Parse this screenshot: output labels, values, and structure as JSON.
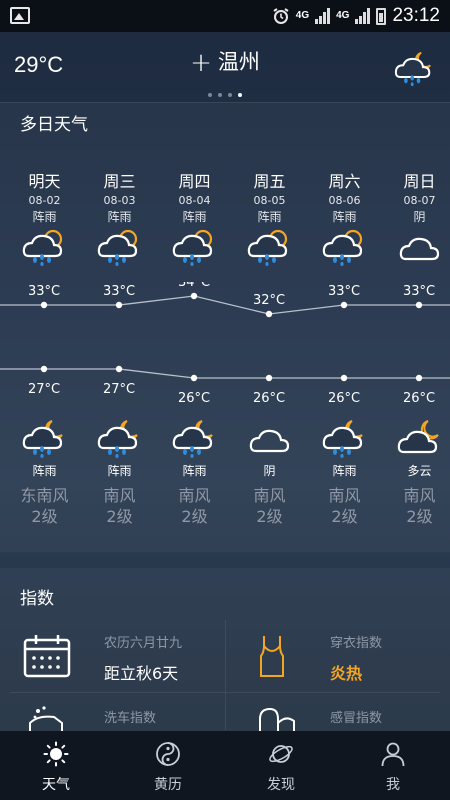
{
  "status_bar": {
    "time": "23:12",
    "network_top": "4G",
    "network_bottom": "4G"
  },
  "header": {
    "current_temp": "29°C",
    "plus": "+",
    "city": "温州",
    "weather_icon": "rain-night-icon"
  },
  "multi_day": {
    "title": "多日天气",
    "days": [
      {
        "name": "明天",
        "date": "08-02",
        "day_condition": "阵雨",
        "day_icon": "rain-day-icon",
        "high": "33°C",
        "low": "27°C",
        "night_icon": "rain-night-icon",
        "night_condition": "阵雨",
        "wind_dir": "东南风",
        "wind_level": "2级"
      },
      {
        "name": "周三",
        "date": "08-03",
        "day_condition": "阵雨",
        "day_icon": "rain-day-icon",
        "high": "33°C",
        "low": "27°C",
        "night_icon": "rain-night-icon",
        "night_condition": "阵雨",
        "wind_dir": "南风",
        "wind_level": "2级"
      },
      {
        "name": "周四",
        "date": "08-04",
        "day_condition": "阵雨",
        "day_icon": "rain-day-icon",
        "high": "34°C",
        "low": "26°C",
        "night_icon": "rain-night-icon",
        "night_condition": "阵雨",
        "wind_dir": "南风",
        "wind_level": "2级"
      },
      {
        "name": "周五",
        "date": "08-05",
        "day_condition": "阵雨",
        "day_icon": "rain-day-icon",
        "high": "32°C",
        "low": "26°C",
        "night_icon": "cloud-icon",
        "night_condition": "阴",
        "wind_dir": "南风",
        "wind_level": "2级"
      },
      {
        "name": "周六",
        "date": "08-06",
        "day_condition": "阵雨",
        "day_icon": "rain-day-icon",
        "high": "33°C",
        "low": "26°C",
        "night_icon": "rain-night-icon",
        "night_condition": "阵雨",
        "wind_dir": "南风",
        "wind_level": "2级"
      },
      {
        "name": "周日",
        "date": "08-07",
        "day_condition": "阴",
        "day_icon": "cloud-icon",
        "high": "33°C",
        "low": "26°C",
        "night_icon": "partly-cloudy-night-icon",
        "night_condition": "多云",
        "wind_dir": "南风",
        "wind_level": "2级"
      }
    ]
  },
  "chart_data": {
    "type": "line",
    "categories": [
      "明天",
      "周三",
      "周四",
      "周五",
      "周六",
      "周日"
    ],
    "series": [
      {
        "values": [
          33,
          33,
          34,
          32,
          33,
          33
        ]
      },
      {
        "values": [
          27,
          27,
          26,
          26,
          26,
          26
        ]
      }
    ]
  },
  "index": {
    "title": "指数",
    "tiles": [
      {
        "name": "农历六月廿九",
        "value": "距立秋6天",
        "icon": "calendar-icon"
      },
      {
        "name": "穿衣指数",
        "value": "炎热",
        "icon": "tank-top-icon",
        "value_color": "#f2a623"
      },
      {
        "name": "洗车指数",
        "value": "",
        "icon": "car-wash-icon"
      },
      {
        "name": "感冒指数",
        "value": "",
        "icon": "cold-index-icon"
      }
    ]
  },
  "nav": {
    "items": [
      {
        "label": "天气",
        "icon": "sun-icon",
        "active": true
      },
      {
        "label": "黄历",
        "icon": "yin-yang-icon",
        "active": false
      },
      {
        "label": "发现",
        "icon": "planet-icon",
        "active": false
      },
      {
        "label": "我",
        "icon": "person-icon",
        "active": false
      }
    ]
  },
  "colors": {
    "accent": "#f2a623",
    "rain": "#2d8ee0"
  }
}
